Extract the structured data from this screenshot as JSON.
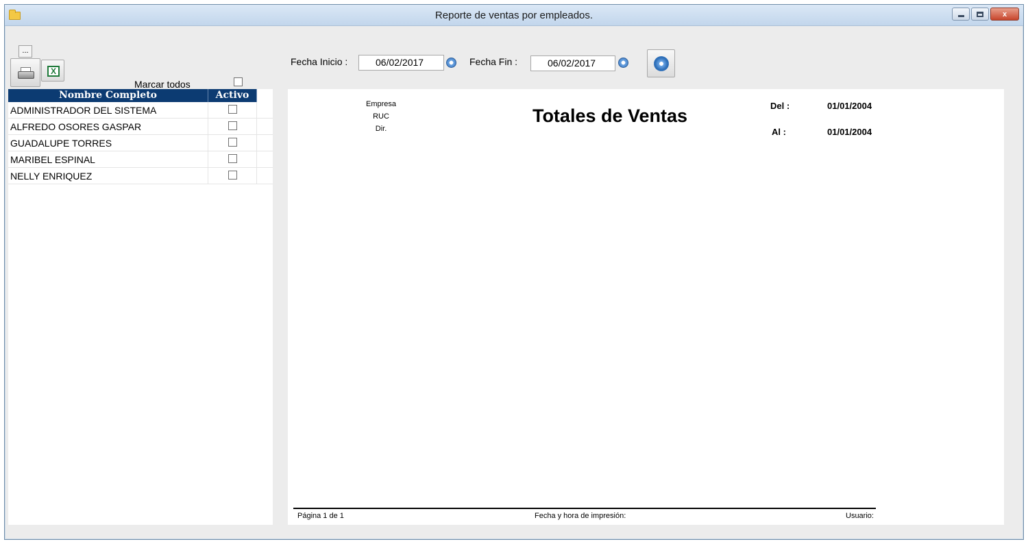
{
  "window": {
    "title": "Reporte de ventas por empleados.",
    "controls": {
      "minimize": "minimize",
      "maximize": "maximize",
      "close": "x"
    }
  },
  "toolbar": {
    "ellipsis_label": "...",
    "print_icon": "printer-icon",
    "excel_icon": "excel-icon",
    "excel_glyph": "X",
    "marcar_todos_label": "Marcar todos",
    "marcar_todos_checked": false
  },
  "grid": {
    "columns": [
      "Nombre Completo",
      "Activo"
    ],
    "rows": [
      {
        "name": "ADMINISTRADOR DEL SISTEMA",
        "activo": false
      },
      {
        "name": "ALFREDO OSORES GASPAR",
        "activo": false
      },
      {
        "name": "GUADALUPE TORRES",
        "activo": false
      },
      {
        "name": "MARIBEL ESPINAL",
        "activo": false
      },
      {
        "name": "NELLY ENRIQUEZ",
        "activo": false
      }
    ]
  },
  "filters": {
    "fecha_inicio_label": "Fecha Inicio :",
    "fecha_inicio_value": "06/02/2017",
    "fecha_fin_label": "Fecha Fin :",
    "fecha_fin_value": "06/02/2017",
    "generate_icon": "gear-icon"
  },
  "report": {
    "empresa_label": "Empresa",
    "ruc_label": "RUC",
    "dir_label": "Dir.",
    "title": "Totales de Ventas",
    "del_label": "Del :",
    "del_value": "01/01/2004",
    "al_label": "Al :",
    "al_value": "01/01/2004",
    "footer_pagina": "Página 1 de 1",
    "footer_fecha": "Fecha y hora de impresión:",
    "footer_usuario": "Usuario:"
  },
  "colors": {
    "grid_header_bg": "#0c3b72",
    "window_bg": "#ececec",
    "titlebar": "#c2d6ec"
  }
}
